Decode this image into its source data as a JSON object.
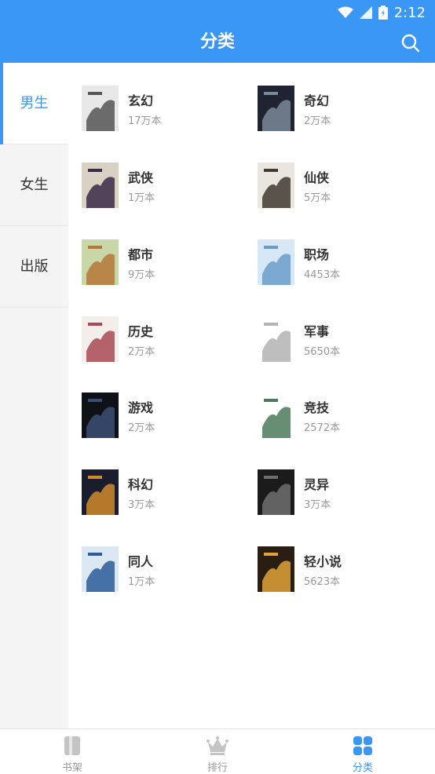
{
  "status_bar": {
    "time": "2:12"
  },
  "header": {
    "title": "分类",
    "search_icon": "search-icon"
  },
  "sidebar": {
    "items": [
      {
        "label": "男生",
        "active": true
      },
      {
        "label": "女生",
        "active": false
      },
      {
        "label": "出版",
        "active": false
      }
    ]
  },
  "categories": [
    {
      "name": "玄幻",
      "count": "17万本",
      "cover_colors": [
        "#e8e8e8",
        "#555555"
      ]
    },
    {
      "name": "奇幻",
      "count": "2万本",
      "cover_colors": [
        "#1f2430",
        "#7b8898"
      ]
    },
    {
      "name": "武侠",
      "count": "1万本",
      "cover_colors": [
        "#d9d2c4",
        "#3a2a48"
      ]
    },
    {
      "name": "仙侠",
      "count": "5万本",
      "cover_colors": [
        "#e9e6df",
        "#403833"
      ]
    },
    {
      "name": "都市",
      "count": "9万本",
      "cover_colors": [
        "#c9d6a8",
        "#b6783a"
      ]
    },
    {
      "name": "职场",
      "count": "4453本",
      "cover_colors": [
        "#d6e8f5",
        "#6b9cc7"
      ]
    },
    {
      "name": "历史",
      "count": "2万本",
      "cover_colors": [
        "#f3eeea",
        "#a84a55"
      ]
    },
    {
      "name": "军事",
      "count": "5650本",
      "cover_colors": [
        "#ffffff",
        "#b3b3b3"
      ]
    },
    {
      "name": "游戏",
      "count": "2万本",
      "cover_colors": [
        "#0e1116",
        "#3c4f73"
      ]
    },
    {
      "name": "竞技",
      "count": "2572本",
      "cover_colors": [
        "#ffffff",
        "#4a7a5a"
      ]
    },
    {
      "name": "科幻",
      "count": "3万本",
      "cover_colors": [
        "#1a1d2e",
        "#d08a2a"
      ]
    },
    {
      "name": "灵异",
      "count": "3万本",
      "cover_colors": [
        "#1b1b1b",
        "#6e6e6e"
      ]
    },
    {
      "name": "同人",
      "count": "1万本",
      "cover_colors": [
        "#dbe7f2",
        "#2a5c9a"
      ]
    },
    {
      "name": "轻小说",
      "count": "5623本",
      "cover_colors": [
        "#2a1d12",
        "#e0a23a"
      ]
    }
  ],
  "bottom_nav": {
    "items": [
      {
        "label": "书架",
        "icon": "bookshelf-icon",
        "active": false
      },
      {
        "label": "排行",
        "icon": "crown-icon",
        "active": false
      },
      {
        "label": "分类",
        "icon": "grid-icon",
        "active": true
      }
    ]
  },
  "colors": {
    "accent": "#3a97f5",
    "sidebar_bg": "#f4f4f4",
    "muted_text": "#999999"
  }
}
